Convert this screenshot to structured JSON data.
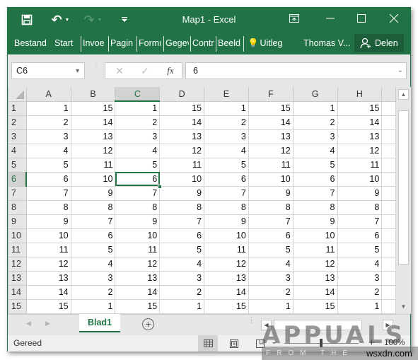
{
  "window": {
    "title": "Map1 - Excel",
    "accent_color": "#217346",
    "quick_access": [
      {
        "name": "save-icon",
        "glyph": "💾"
      },
      {
        "name": "undo-icon",
        "glyph": "↶"
      },
      {
        "name": "redo-icon",
        "glyph": "↷"
      },
      {
        "name": "customize-qat-icon",
        "glyph": "⩡"
      }
    ],
    "controls": {
      "ribbon_display": "ribbon-display-options-icon",
      "minimize": "minimize-icon",
      "maximize": "maximize-icon",
      "close": "close-icon"
    }
  },
  "ribbon": {
    "tabs": [
      "Bestand",
      "Start",
      "Invoe",
      "Pagin",
      "Formı",
      "Gegev",
      "Contr",
      "Beeld"
    ],
    "tell_me": "Uitleg",
    "user": "Thomas V...",
    "share": "Delen"
  },
  "formula_bar": {
    "name_box": "C6",
    "cancel_icon": "✕",
    "enter_icon": "✓",
    "fx_label": "fx",
    "value": "6"
  },
  "grid": {
    "columns": [
      "A",
      "B",
      "C",
      "D",
      "E",
      "F",
      "G",
      "H"
    ],
    "selected_cell": {
      "column": "C",
      "row": 6
    },
    "rows": [
      {
        "row": "1",
        "cells": [
          1,
          15,
          1,
          15,
          1,
          15,
          1,
          15
        ]
      },
      {
        "row": "2",
        "cells": [
          2,
          14,
          2,
          14,
          2,
          14,
          2,
          14
        ]
      },
      {
        "row": "3",
        "cells": [
          3,
          13,
          3,
          13,
          3,
          13,
          3,
          13
        ]
      },
      {
        "row": "4",
        "cells": [
          4,
          12,
          4,
          12,
          4,
          12,
          4,
          12
        ]
      },
      {
        "row": "5",
        "cells": [
          5,
          11,
          5,
          11,
          5,
          11,
          5,
          11
        ]
      },
      {
        "row": "6",
        "cells": [
          6,
          10,
          6,
          10,
          6,
          10,
          6,
          10
        ]
      },
      {
        "row": "7",
        "cells": [
          7,
          9,
          7,
          9,
          7,
          9,
          7,
          9
        ]
      },
      {
        "row": "8",
        "cells": [
          8,
          8,
          8,
          8,
          8,
          8,
          8,
          8
        ]
      },
      {
        "row": "9",
        "cells": [
          9,
          7,
          9,
          7,
          9,
          7,
          9,
          7
        ]
      },
      {
        "row": "10",
        "cells": [
          10,
          6,
          10,
          6,
          10,
          6,
          10,
          6
        ]
      },
      {
        "row": "11",
        "cells": [
          11,
          5,
          11,
          5,
          11,
          5,
          11,
          5
        ]
      },
      {
        "row": "12",
        "cells": [
          12,
          4,
          12,
          4,
          12,
          4,
          12,
          4
        ]
      },
      {
        "row": "13",
        "cells": [
          13,
          3,
          13,
          3,
          13,
          3,
          13,
          3
        ]
      },
      {
        "row": "14",
        "cells": [
          14,
          2,
          14,
          2,
          14,
          2,
          14,
          2
        ]
      },
      {
        "row": "15",
        "cells": [
          15,
          1,
          15,
          1,
          15,
          1,
          15,
          1
        ]
      }
    ]
  },
  "sheets": {
    "tabs": [
      "Blad1"
    ],
    "active": "Blad1",
    "add_label": "+"
  },
  "status": {
    "text": "Gereed",
    "zoom_minus": "-",
    "zoom_plus": "+",
    "zoom_level": "100%"
  },
  "watermark": {
    "brand": "APPUALS",
    "tagline": "FROM THE EXPERTS",
    "site": "wsxdn.com"
  }
}
